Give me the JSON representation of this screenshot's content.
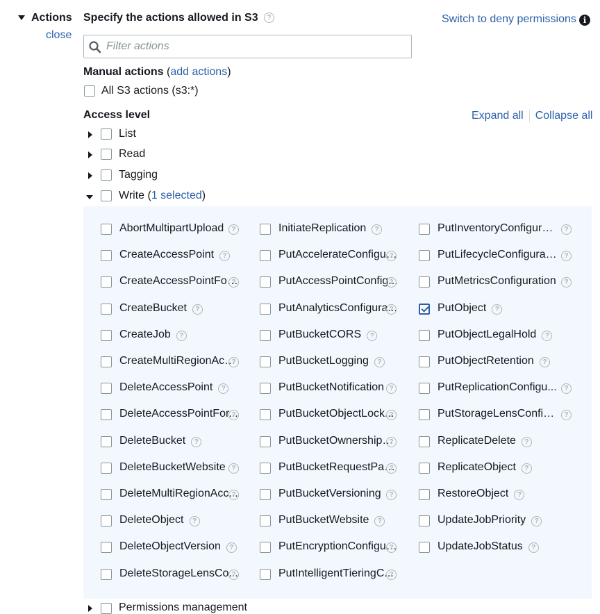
{
  "sidebar": {
    "title": "Actions",
    "close_label": "close"
  },
  "header": {
    "title": "Specify the actions allowed in S3",
    "switch_label": "Switch to deny permissions",
    "info_glyph": "i"
  },
  "filter": {
    "placeholder": "Filter actions",
    "value": ""
  },
  "manual": {
    "title": "Manual actions",
    "open_paren": "(",
    "add_label": "add actions",
    "close_paren": ")",
    "all_label": "All S3 actions (s3:*)"
  },
  "access": {
    "title": "Access level",
    "expand_label": "Expand all",
    "collapse_label": "Collapse all",
    "levels": [
      {
        "label": "List",
        "expanded": false
      },
      {
        "label": "Read",
        "expanded": false
      },
      {
        "label": "Tagging",
        "expanded": false
      },
      {
        "label": "Write",
        "expanded": true,
        "selected_text": "1 selected"
      }
    ],
    "next_level_label": "Permissions management"
  },
  "write_actions": {
    "col1": [
      "AbortMultipartUpload",
      "CreateAccessPoint",
      "CreateAccessPointFor...",
      "CreateBucket",
      "CreateJob",
      "CreateMultiRegionAcc...",
      "DeleteAccessPoint",
      "DeleteAccessPointFor...",
      "DeleteBucket",
      "DeleteBucketWebsite",
      "DeleteMultiRegionAcc...",
      "DeleteObject",
      "DeleteObjectVersion",
      "DeleteStorageLensCo..."
    ],
    "col2": [
      "InitiateReplication",
      "PutAccelerateConfigur...",
      "PutAccessPointConfig...",
      "PutAnalyticsConfigura...",
      "PutBucketCORS",
      "PutBucketLogging",
      "PutBucketNotification",
      "PutBucketObjectLock...",
      "PutBucketOwnershipC...",
      "PutBucketRequestPay...",
      "PutBucketVersioning",
      "PutBucketWebsite",
      "PutEncryptionConfigur...",
      "PutIntelligentTieringC..."
    ],
    "col3": [
      "PutInventoryConfigura...",
      "PutLifecycleConfigurat...",
      "PutMetricsConfiguration",
      "PutObject",
      "PutObjectLegalHold",
      "PutObjectRetention",
      "PutReplicationConfigu...",
      "PutStorageLensConfig...",
      "ReplicateDelete",
      "ReplicateObject",
      "RestoreObject",
      "UpdateJobPriority",
      "UpdateJobStatus"
    ],
    "checked": [
      "PutObject"
    ]
  },
  "colors": {
    "link": "#2b5fa8",
    "panel_bg": "#f2f8fd",
    "border": "#879596"
  },
  "help_glyph": "?"
}
